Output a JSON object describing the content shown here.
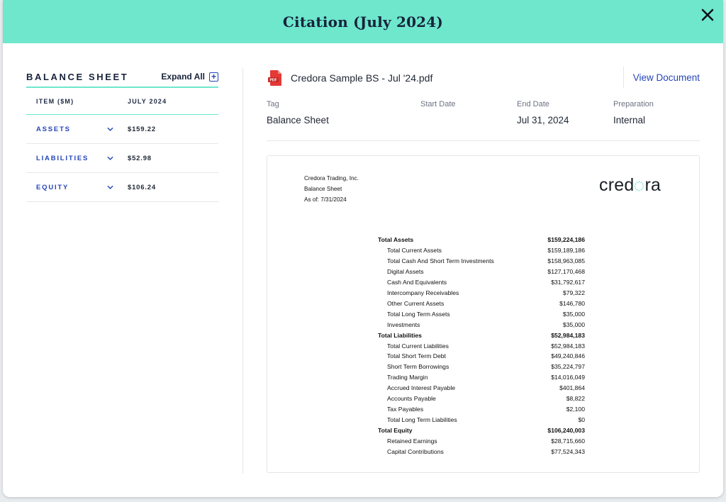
{
  "modal": {
    "title": "Citation (July 2024)"
  },
  "left_panel": {
    "title": "BALANCE SHEET",
    "expand_all": "Expand All",
    "columns": [
      "ITEM ($M)",
      "JULY 2024"
    ],
    "rows": [
      {
        "label": "ASSETS",
        "value": "$159.22"
      },
      {
        "label": "LIABILITIES",
        "value": "$52.98"
      },
      {
        "label": "EQUITY",
        "value": "$106.24"
      }
    ]
  },
  "document": {
    "file_name": "Credora Sample BS - Jul '24.pdf",
    "pdf_badge": "PDF",
    "view_label": "View Document",
    "meta": [
      {
        "label": "Tag",
        "value": "Balance Sheet"
      },
      {
        "label": "Start Date",
        "value": ""
      },
      {
        "label": "End Date",
        "value": "Jul 31, 2024"
      },
      {
        "label": "Preparation",
        "value": "Internal"
      }
    ]
  },
  "preview": {
    "company": "Credora Trading, Inc.",
    "statement": "Balance Sheet",
    "as_of": "As of: 7/31/2024",
    "logo_text": "credora",
    "lines": [
      {
        "name": "Total Assets",
        "value": "$159,224,186",
        "level": 0
      },
      {
        "name": "Total Current Assets",
        "value": "$159,189,186",
        "level": 1
      },
      {
        "name": "Total Cash And Short Term Investments",
        "value": "$158,963,085",
        "level": 1
      },
      {
        "name": "Digital Assets",
        "value": "$127,170,468",
        "level": 1
      },
      {
        "name": "Cash And Equivalents",
        "value": "$31,792,617",
        "level": 1
      },
      {
        "name": "Intercompany Receivables",
        "value": "$79,322",
        "level": 1
      },
      {
        "name": "Other Current Assets",
        "value": "$146,780",
        "level": 1
      },
      {
        "name": "Total Long Term Assets",
        "value": "$35,000",
        "level": 1
      },
      {
        "name": "Investments",
        "value": "$35,000",
        "level": 1
      },
      {
        "name": "Total Liabilities",
        "value": "$52,984,183",
        "level": 0
      },
      {
        "name": "Total Current Liabilities",
        "value": "$52,984,183",
        "level": 1
      },
      {
        "name": "Total Short Term Debt",
        "value": "$49,240,846",
        "level": 1
      },
      {
        "name": "Short Term Borrowings",
        "value": "$35,224,797",
        "level": 1
      },
      {
        "name": "Trading Margin",
        "value": "$14,016,049",
        "level": 1
      },
      {
        "name": "Accrued Interest Payable",
        "value": "$401,864",
        "level": 1
      },
      {
        "name": "Accounts Payable",
        "value": "$8,822",
        "level": 1
      },
      {
        "name": "Tax Payables",
        "value": "$2,100",
        "level": 1
      },
      {
        "name": "Total Long Term Liabilities",
        "value": "$0",
        "level": 1
      },
      {
        "name": "Total Equity",
        "value": "$106,240,003",
        "level": 0
      },
      {
        "name": "Retained Earnings",
        "value": "$28,715,660",
        "level": 1
      },
      {
        "name": "Capital Contributions",
        "value": "$77,524,343",
        "level": 1
      }
    ]
  },
  "colors": {
    "header": "#6ee7cd",
    "accent": "#2546b8",
    "pdf": "#e53935"
  },
  "icons": {
    "close": "close-icon",
    "expand": "plus-square-icon",
    "row": "chevron-down-icon",
    "file": "pdf-file-icon"
  }
}
